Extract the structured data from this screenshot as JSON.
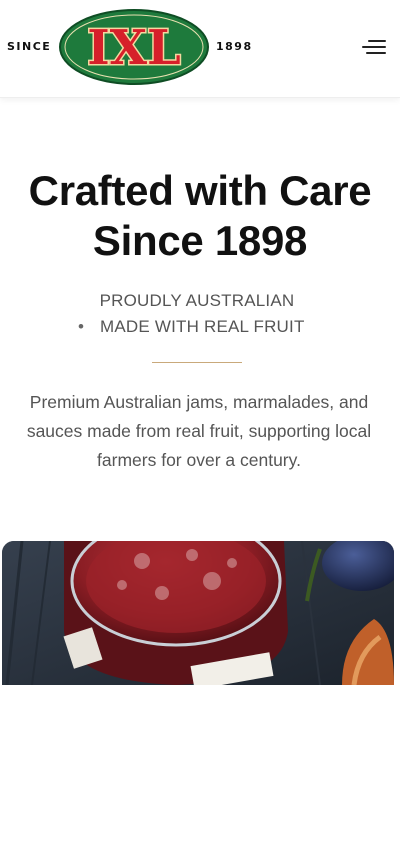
{
  "header": {
    "since_label": "SINCE",
    "year_label": "1898",
    "logo_text": "IXL",
    "menu_icon": "hamburger-menu-icon"
  },
  "hero": {
    "title_line1": "Crafted with Care",
    "title_line2": "Since 1898",
    "tagline_1": "PROUDLY AUSTRALIAN",
    "tagline_2_bullet": "•",
    "tagline_2": "MADE WITH REAL FRUIT",
    "description": "Premium Australian jams, marmalades, and sauces made from real fruit, supporting local farmers for over a century."
  },
  "colors": {
    "logo_green": "#1e7a3c",
    "logo_red": "#d6202a",
    "divider_gold": "#c9a97b",
    "text_gray": "#555555"
  }
}
